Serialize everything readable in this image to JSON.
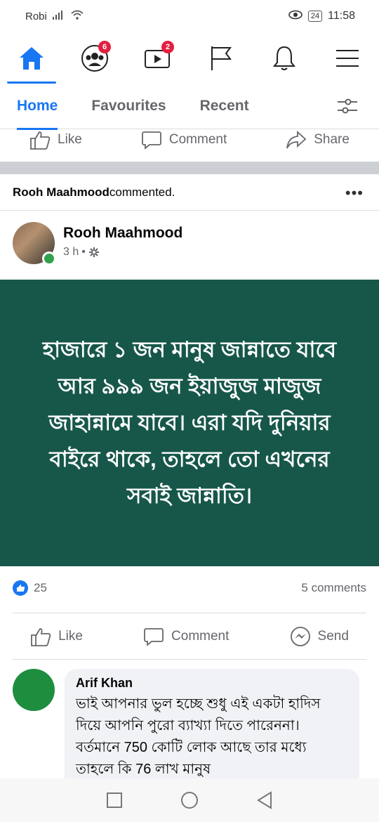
{
  "status_bar": {
    "carrier": "Robi",
    "battery": "24",
    "time": "11:58"
  },
  "nav": {
    "groups_badge": "6",
    "watch_badge": "2"
  },
  "tabs": [
    "Home",
    "Favourites",
    "Recent"
  ],
  "actions_prev": {
    "like": "Like",
    "comment": "Comment",
    "share": "Share"
  },
  "activity": {
    "name": "Rooh Maahmood",
    "text": " commented."
  },
  "post": {
    "author": "Rooh Maahmood",
    "time": "3 h",
    "text": "হাজারে ১ জন মানুষ জান্নাতে যাবে আর ৯৯৯ জন ইয়াজুজ মাজুজ জাহান্নামে যাবে। এরা যদি দুনিয়ার বাইরে থাকে, তাহলে তো এখনের সবাই জান্নাতি।",
    "likes": "25",
    "comments": "5 comments",
    "bg_color": "#17574a"
  },
  "actions": {
    "like": "Like",
    "comment": "Comment",
    "send": "Send"
  },
  "comment": {
    "name": "Arif Khan",
    "text": "ভাই আপনার ভুল হচ্ছে শুধু এই একটা হাদিস দিয়ে আপনি পুরো ব্যাখ্যা দিতে পারেননা। বর্তমানে 750 কোটি লোক আছে তার মধ্যে তাহলে কি 76 লাখ মানুষ"
  },
  "colors": {
    "accent": "#1877f2",
    "badge": "#e41e3f",
    "online": "#31a24c"
  }
}
